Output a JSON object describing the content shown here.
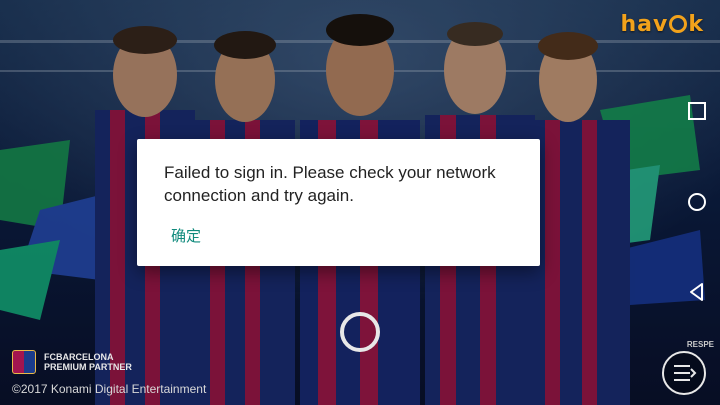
{
  "logo": {
    "left": "hav",
    "right": "k"
  },
  "dialog": {
    "message": "Failed to sign in. Please check your network connection and try again.",
    "confirm_label": "确定"
  },
  "footer": {
    "partner_line1": "FCBARCELONA",
    "partner_line2": "PREMIUM PARTNER",
    "copyright": "©2017 Konami Digital Entertainment",
    "respect": "RESPE"
  },
  "nav": {
    "recents_icon": "square-icon",
    "home_icon": "circle-icon",
    "back_icon": "triangle-back-icon"
  },
  "colors": {
    "accent": "#0f8a7c",
    "logo": "#f2a21b"
  }
}
